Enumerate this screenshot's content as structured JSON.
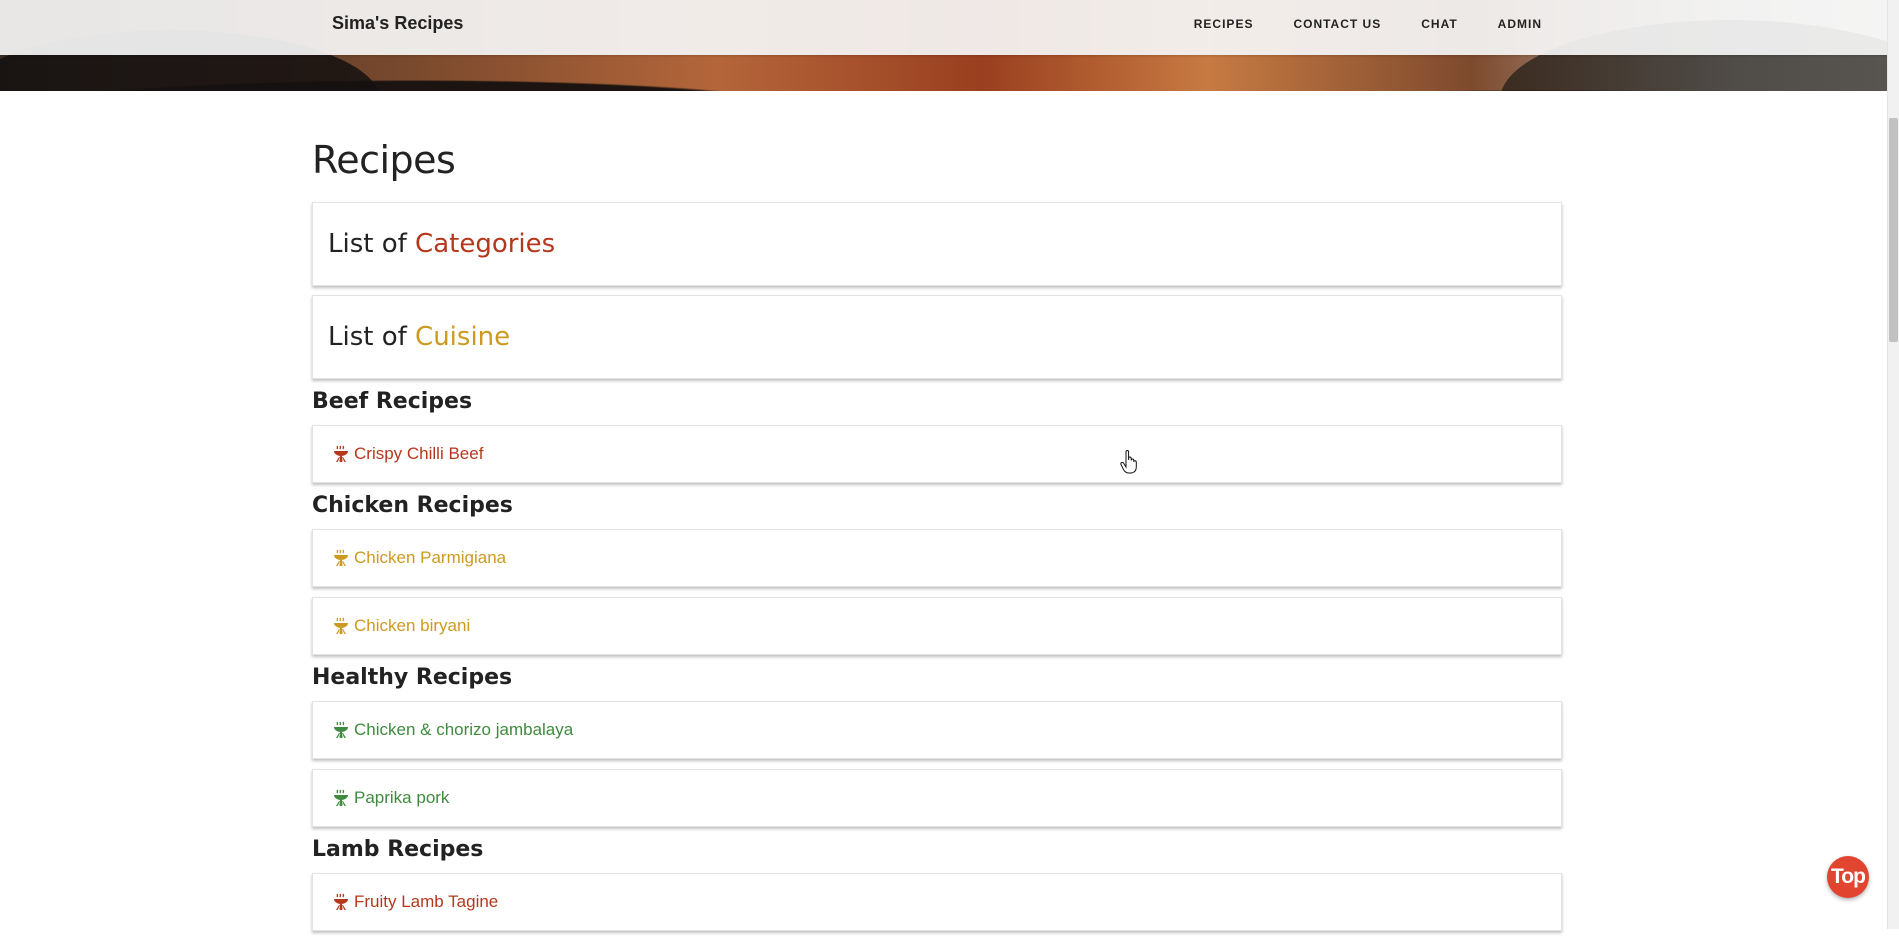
{
  "navbar": {
    "brand": "Sima's Recipes",
    "links": [
      "RECIPES",
      "CONTACT US",
      "CHAT",
      "ADMIN"
    ]
  },
  "page": {
    "title": "Recipes",
    "panels": [
      {
        "prefix": "List of",
        "highlight": "Categories"
      },
      {
        "prefix": "List of",
        "highlight": "Cuisine"
      }
    ]
  },
  "sections": [
    {
      "heading": "Beef Recipes",
      "color": "#b5381d",
      "recipes": [
        "Crispy Chilli Beef"
      ]
    },
    {
      "heading": "Chicken Recipes",
      "color": "#cc9a20",
      "recipes": [
        "Chicken Parmigiana",
        "Chicken biryani"
      ]
    },
    {
      "heading": "Healthy Recipes",
      "color": "#3f8a3f",
      "recipes": [
        "Chicken & chorizo jambalaya",
        "Paprika pork"
      ]
    },
    {
      "heading": "Lamb Recipes",
      "color": "#b5381d",
      "recipes": [
        "Fruity Lamb Tagine"
      ]
    }
  ],
  "icons": {
    "recipe": "bbq-grill-icon"
  },
  "back_to_top": "Top"
}
